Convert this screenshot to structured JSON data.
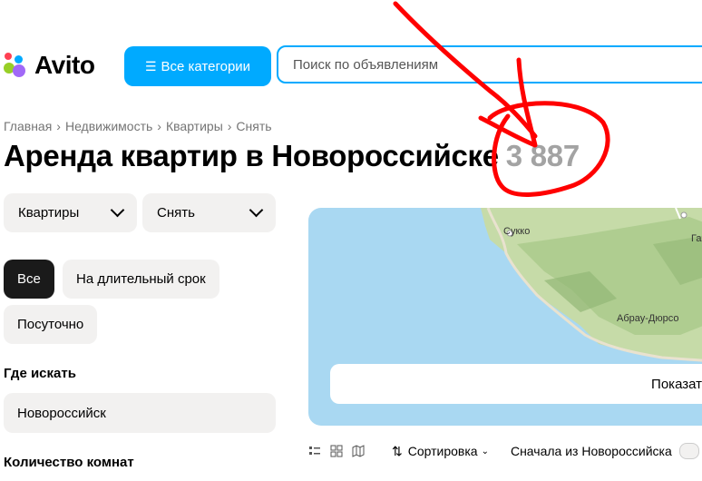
{
  "header": {
    "logo_text": "Avito",
    "logo_colors": [
      "#00aaff",
      "#ff4053",
      "#97cf26",
      "#a169f7"
    ],
    "categories_button": "Все категории",
    "categories_icon": "menu-search-icon",
    "search_placeholder": "Поиск по объявлениям"
  },
  "breadcrumb": [
    "Главная",
    "Недвижимость",
    "Квартиры",
    "Снять"
  ],
  "page": {
    "title": "Аренда квартир в Новороссийске",
    "count": "3 887"
  },
  "filters": {
    "type_select": "Квартиры",
    "deal_select": "Снять",
    "term_options": [
      "Все",
      "На длительный срок",
      "Посуточно"
    ],
    "term_selected": "Все",
    "where_label": "Где искать",
    "city": "Новороссийск",
    "rooms_label": "Количество комнат"
  },
  "map": {
    "labels": [
      "Сукко",
      "Абрау-Дюрсо",
      "Га"
    ],
    "show_button": "Показат"
  },
  "toolbar": {
    "view_icons": [
      "list-view-icon",
      "grid-view-icon",
      "map-view-icon"
    ],
    "sort_label": "Сортировка",
    "first_city": "Сначала из Новороссийска"
  },
  "colors": {
    "accent": "#00aaff",
    "annotation": "#ff0000",
    "active_pill": "#1a1a1a",
    "chip_bg": "#f2f1f0"
  }
}
